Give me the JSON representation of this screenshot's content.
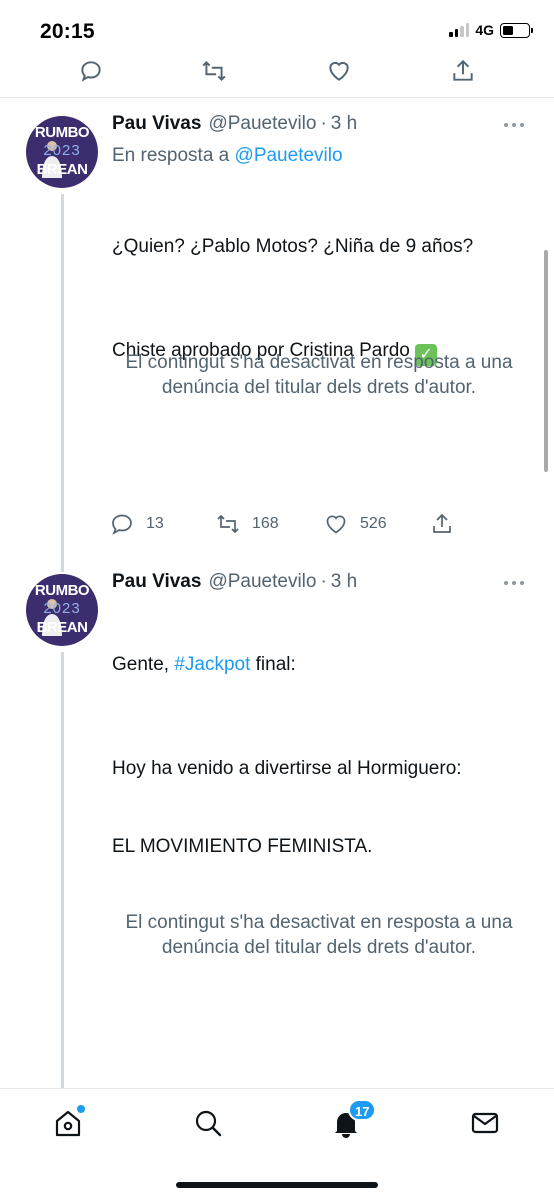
{
  "status_bar": {
    "time": "20:15",
    "network": "4G"
  },
  "colors": {
    "accent": "#1d9bf0",
    "secondary_text": "#536471",
    "thread_line": "#cfd9de"
  },
  "top_actions": {
    "icons": [
      "reply-icon",
      "retweet-icon",
      "like-icon",
      "share-icon"
    ]
  },
  "tweets": [
    {
      "display_name": "Pau Vivas",
      "handle": "@Pauetevilo",
      "time": "3 h",
      "reply_prefix": "En resposta a",
      "reply_mention": "@Pauetevilo",
      "text_line1": "¿Quien? ¿Pablo Motos? ¿Niña de 9 años?",
      "text_line2": "Chiste aprobado por Cristina Pardo",
      "text_emoji": "✓",
      "media_notice": "El contingut s'ha desactivat en resposta a una denúncia del titular dels drets d'autor.",
      "replies": "13",
      "retweets": "168",
      "likes": "526",
      "avatar_text": [
        "RUMBO",
        "2023",
        "BREAN"
      ]
    },
    {
      "display_name": "Pau Vivas",
      "handle": "@Pauetevilo",
      "time": "3 h",
      "text_prefix": "Gente, ",
      "hashtag": "#Jackpot",
      "text_suffix": " final:",
      "text_line2": "Hoy ha venido a divertirse al Hormiguero:",
      "text_line3": "EL MOVIMIENTO FEMINISTA.",
      "media_notice": "El contingut s'ha desactivat en resposta a una denúncia del titular dels drets d'autor.",
      "avatar_text": [
        "RUMBO",
        "2023",
        "BREAN"
      ]
    }
  ],
  "tab_bar": {
    "tabs": [
      "home-icon",
      "search-icon",
      "notifications-icon",
      "messages-icon"
    ],
    "notification_count": "17"
  }
}
